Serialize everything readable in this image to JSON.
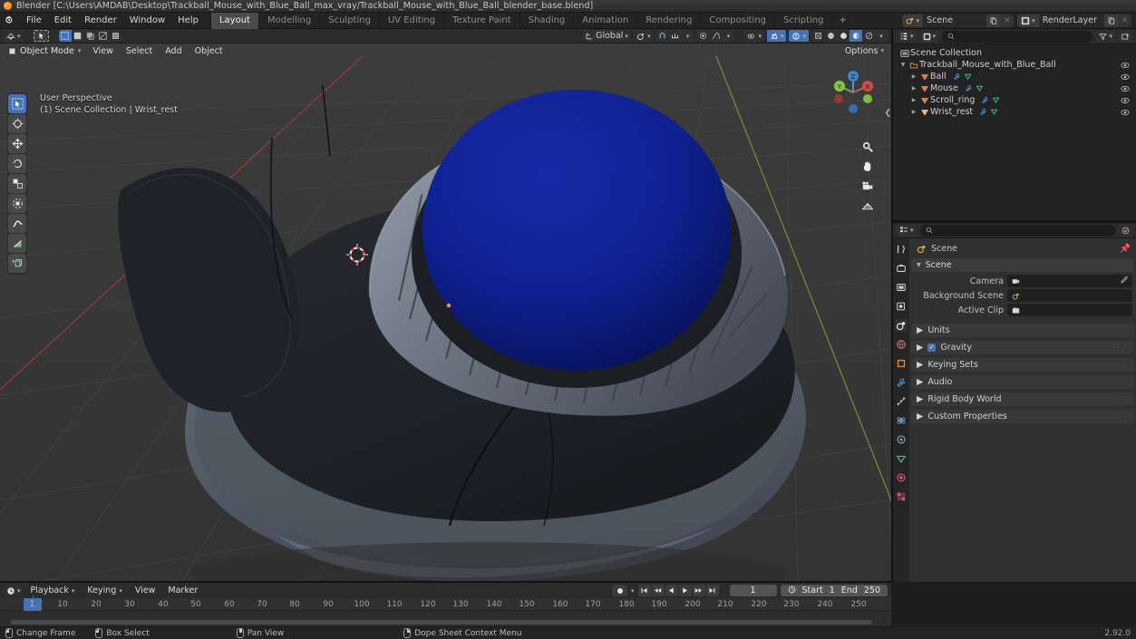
{
  "window": {
    "title": "Blender [C:\\Users\\AMDAB\\Desktop\\Trackball_Mouse_with_Blue_Ball_max_vray/Trackball_Mouse_with_Blue_Ball_blender_base.blend]"
  },
  "topbar": {
    "menus": [
      "File",
      "Edit",
      "Render",
      "Window",
      "Help"
    ],
    "workspaces": [
      {
        "label": "Layout",
        "active": true
      },
      {
        "label": "Modelling",
        "active": false
      },
      {
        "label": "Sculpting",
        "active": false
      },
      {
        "label": "UV Editing",
        "active": false
      },
      {
        "label": "Texture Paint",
        "active": false
      },
      {
        "label": "Shading",
        "active": false
      },
      {
        "label": "Animation",
        "active": false
      },
      {
        "label": "Rendering",
        "active": false
      },
      {
        "label": "Compositing",
        "active": false
      },
      {
        "label": "Scripting",
        "active": false
      }
    ],
    "add_workspace": "+",
    "scene_name": "Scene",
    "viewlayer_name": "RenderLayer"
  },
  "viewport": {
    "mode": "Object Mode",
    "menus": [
      "View",
      "Select",
      "Add",
      "Object"
    ],
    "transform_orientation": "Global",
    "options_label": "Options",
    "overlay_line1": "User Perspective",
    "overlay_line2": "(1) Scene Collection | Wrist_rest",
    "gizmo_axes": [
      "Z",
      "Y",
      "X"
    ],
    "background_color": "#3a3a3a",
    "ball_color": "#0d1d8a",
    "body_dark_color": "#212428",
    "body_mid_color": "#4d545e",
    "body_light_color": "#8d94a3",
    "cursor_position": "3d-cursor",
    "tools": [
      "tweak-select-box-tool",
      "cursor-tool",
      "move-tool",
      "rotate-tool",
      "scale-tool",
      "transform-tool",
      "annotate-tool",
      "measure-tool",
      "add-cube-tool"
    ]
  },
  "outliner": {
    "root": "Scene Collection",
    "items": [
      {
        "label": "Trackball_Mouse_with_Blue_Ball",
        "type": "collection",
        "indent": 0
      },
      {
        "label": "Ball",
        "type": "mesh",
        "indent": 1
      },
      {
        "label": "Mouse",
        "type": "mesh",
        "indent": 1
      },
      {
        "label": "Scroll_ring",
        "type": "mesh",
        "indent": 1
      },
      {
        "label": "Wrist_rest",
        "type": "mesh",
        "indent": 1,
        "selected": true
      }
    ]
  },
  "properties": {
    "breadcrumb": "Scene",
    "panel_title": "Scene",
    "rows": [
      {
        "label": "Camera",
        "value": "",
        "icon": "camera-icon"
      },
      {
        "label": "Background Scene",
        "value": "",
        "icon": "scene-icon"
      },
      {
        "label": "Active Clip",
        "value": "",
        "icon": "clip-icon"
      }
    ],
    "panels": [
      {
        "label": "Units",
        "checkbox": false
      },
      {
        "label": "Gravity",
        "checkbox": true
      },
      {
        "label": "Keying Sets",
        "checkbox": false
      },
      {
        "label": "Audio",
        "checkbox": false
      },
      {
        "label": "Rigid Body World",
        "checkbox": false
      },
      {
        "label": "Custom Properties",
        "checkbox": false
      }
    ],
    "tabs": [
      "tool-tab",
      "render-tab",
      "output-tab",
      "view-layer-tab",
      "scene-tab",
      "world-tab",
      "object-tab",
      "modifier-tab",
      "particles-tab",
      "physics-tab",
      "constraints-tab",
      "data-tab",
      "material-tab",
      "texture-tab"
    ]
  },
  "timeline": {
    "menus": [
      "Playback",
      "Keying",
      "View",
      "Marker"
    ],
    "current_frame": "1",
    "start_label": "Start",
    "start_value": "1",
    "end_label": "End",
    "end_value": "250",
    "ticks": [
      "10",
      "20",
      "30",
      "40",
      "50",
      "60",
      "70",
      "80",
      "90",
      "100",
      "110",
      "120",
      "130",
      "140",
      "150",
      "160",
      "170",
      "180",
      "190",
      "200",
      "210",
      "220",
      "230",
      "240",
      "250"
    ]
  },
  "statusbar": {
    "hints": [
      {
        "label": "Change Frame",
        "mouse": "left"
      },
      {
        "label": "Box Select",
        "mouse": "left"
      },
      {
        "label": "Pan View",
        "mouse": "mid"
      },
      {
        "label": "Dope Sheet Context Menu",
        "mouse": "right"
      }
    ],
    "version": "2.92.0"
  }
}
